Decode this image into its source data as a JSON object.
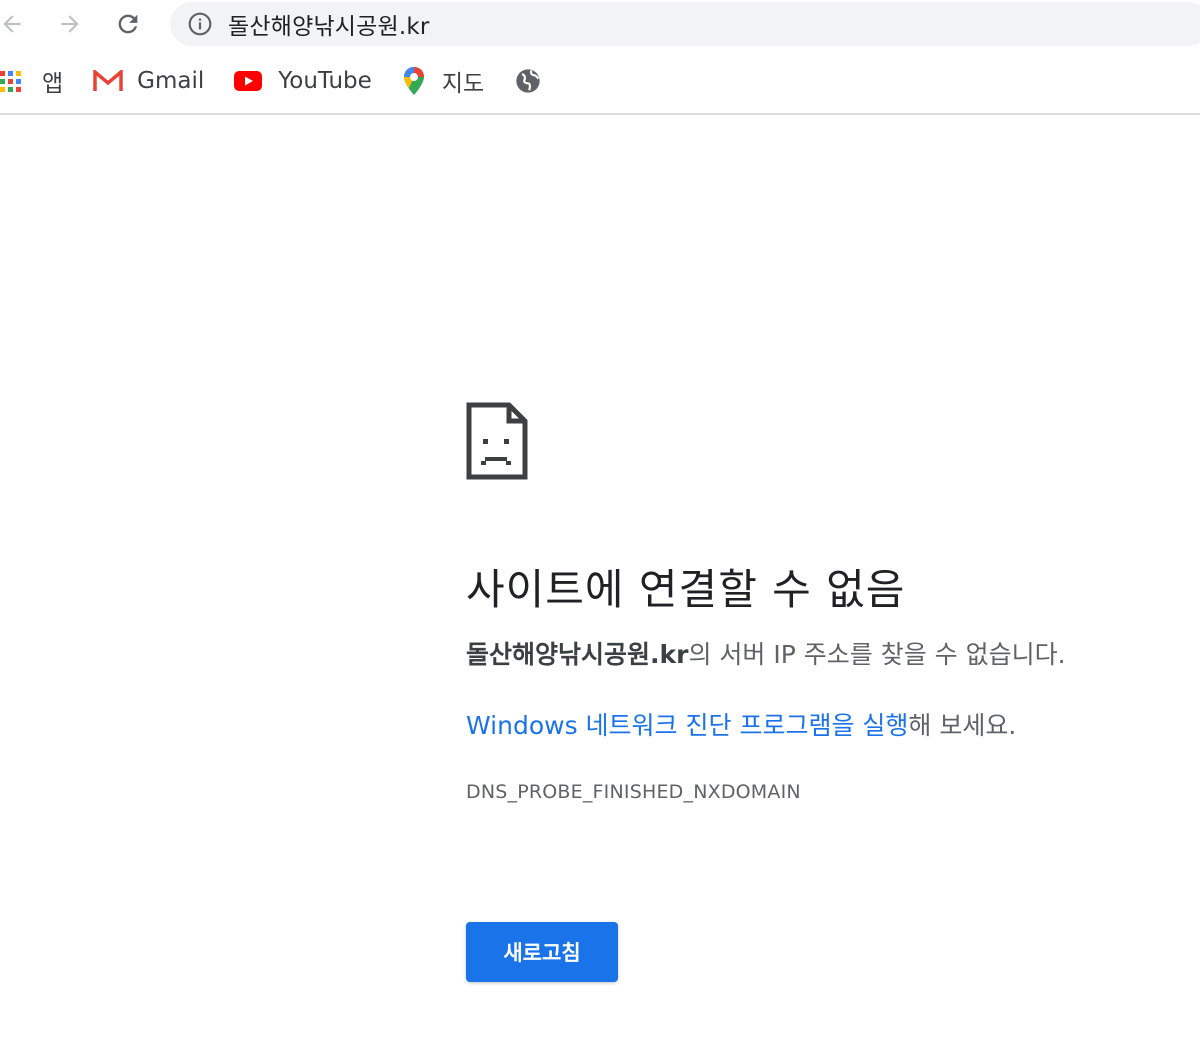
{
  "omnibox": {
    "url": "돌산해양낚시공원.kr"
  },
  "bookmarks": {
    "apps_label": "앱",
    "items": [
      {
        "label": "Gmail",
        "icon": "gmail-icon"
      },
      {
        "label": "YouTube",
        "icon": "youtube-icon"
      },
      {
        "label": "지도",
        "icon": "maps-icon"
      },
      {
        "label": "",
        "icon": "globe-icon"
      }
    ]
  },
  "error": {
    "title": "사이트에 연결할 수 없음",
    "host": "돌산해양낚시공원.kr",
    "desc_suffix": "의 서버 IP 주소를 찾을 수 없습니다.",
    "suggest_link": "Windows 네트워크 진단 프로그램을 실행",
    "suggest_suffix": "해 보세요.",
    "code": "DNS_PROBE_FINISHED_NXDOMAIN",
    "reload_label": "새로고침"
  },
  "colors": {
    "accent": "#1a73e8",
    "omnibox_bg": "#f1f3f4",
    "text_secondary": "#5f6368"
  }
}
